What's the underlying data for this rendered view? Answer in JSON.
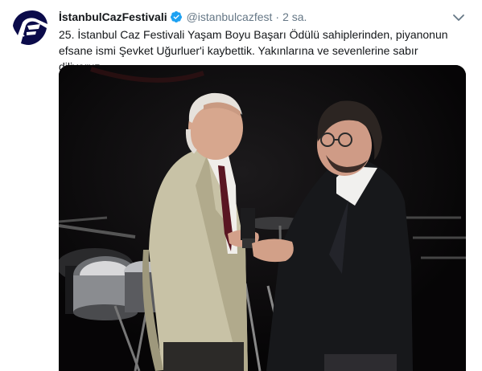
{
  "tweet": {
    "display_name": "İstanbulCazFestivali",
    "handle": "@istanbulcazfest",
    "separator": "·",
    "time": "2 sa.",
    "text": "25. İstanbul Caz Festivali Yaşam Boyu Başarı Ödülü sahiplerinden, piyanonun efsane ismi Şevket Uğurluer'i kaybettik. Yakınlarına ve sevenlerine sabır diliyoruz."
  },
  "icons": {
    "avatar": "festival-logo-icon",
    "verified": "verified-badge-icon",
    "menu": "chevron-down-icon"
  },
  "colors": {
    "verified": "#1da1f2",
    "secondary_text": "#657786",
    "primary_text": "#14171a",
    "logo_dark": "#0b0b4a"
  }
}
